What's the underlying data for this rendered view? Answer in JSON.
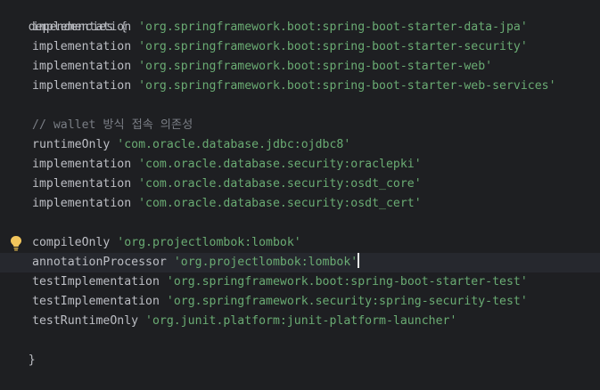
{
  "code": {
    "open_line": "dependencies {",
    "close_line": "}",
    "lines": [
      {
        "fn": "implementation",
        "arg": "'org.springframework.boot:spring-boot-starter-data-jpa'"
      },
      {
        "fn": "implementation",
        "arg": "'org.springframework.boot:spring-boot-starter-security'"
      },
      {
        "fn": "implementation",
        "arg": "'org.springframework.boot:spring-boot-starter-web'"
      },
      {
        "fn": "implementation",
        "arg": "'org.springframework.boot:spring-boot-starter-web-services'"
      },
      {
        "comment": "// wallet 방식 접속 의존성"
      },
      {
        "fn": "runtimeOnly",
        "arg": "'com.oracle.database.jdbc:ojdbc8'"
      },
      {
        "fn": "implementation",
        "arg": "'com.oracle.database.security:oraclepki'"
      },
      {
        "fn": "implementation",
        "arg": "'com.oracle.database.security:osdt_core'"
      },
      {
        "fn": "implementation",
        "arg": "'com.oracle.database.security:osdt_cert'"
      },
      {
        "fn": "compileOnly",
        "arg": "'org.projectlombok:lombok'"
      },
      {
        "fn": "annotationProcessor",
        "arg": "'org.projectlombok:lombok'"
      },
      {
        "fn": "testImplementation",
        "arg": "'org.springframework.boot:spring-boot-starter-test'"
      },
      {
        "fn": "testImplementation",
        "arg": "'org.springframework.security:spring-security-test'"
      },
      {
        "fn": "testRuntimeOnly",
        "arg": "'org.junit.platform:junit-platform-launcher'"
      }
    ]
  },
  "icons": {
    "intention": "lightbulb-icon"
  },
  "colors": {
    "background": "#1e1f22",
    "current_line": "#26282e",
    "identifier": "#bcbec4",
    "string": "#6aab73",
    "comment": "#7a7e85",
    "bulb": "#f2c55c"
  }
}
